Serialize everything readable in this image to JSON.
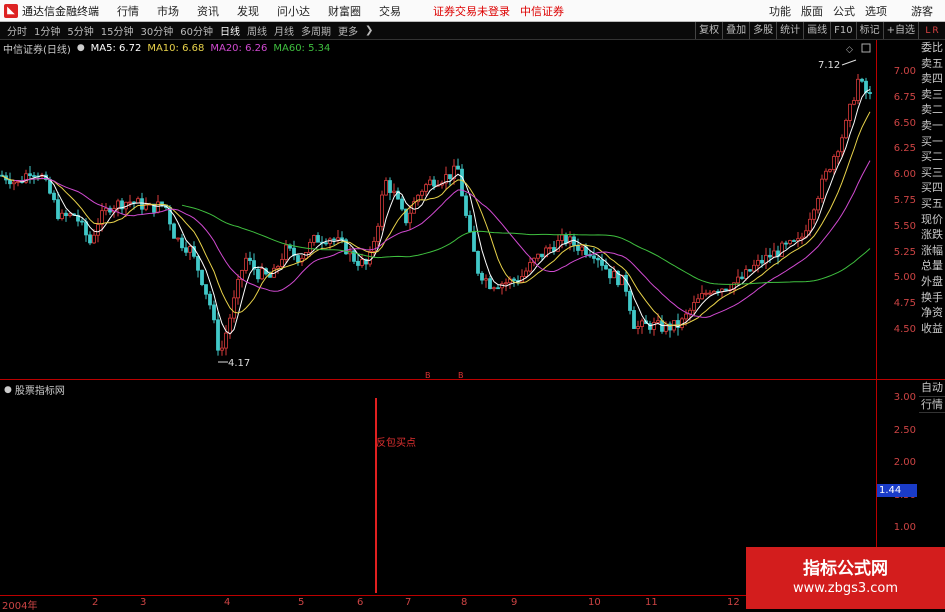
{
  "menubar": {
    "app_title": "通达信金融终端",
    "items": [
      "行情",
      "市场",
      "资讯",
      "发现",
      "问小达",
      "财富圈",
      "交易"
    ],
    "status": "证券交易未登录",
    "broker": "中信证券",
    "right_items": [
      "功能",
      "版面",
      "公式",
      "选项"
    ],
    "guest": "游客"
  },
  "toolbar": {
    "periods": [
      "分时",
      "1分钟",
      "5分钟",
      "15分钟",
      "30分钟",
      "60分钟",
      "日线",
      "周线",
      "月线",
      "多周期",
      "更多"
    ],
    "active_period": "日线",
    "right_buttons": [
      "复权",
      "叠加",
      "多股",
      "统计",
      "画线",
      "F10",
      "标记",
      "+自选",
      "返回"
    ]
  },
  "side_top": {
    "left": "L",
    "right": "R"
  },
  "infobar": {
    "stock": "中信证券(日线)",
    "ma5": "MA5: 6.72",
    "ma10": "MA10: 6.68",
    "ma20": "MA20: 6.26",
    "ma60": "MA60: 5.34"
  },
  "colors": {
    "ma5": "#ffffff",
    "ma10": "#e8d24a",
    "ma20": "#d04ad0",
    "ma60": "#3fbf3f",
    "up": "#d83b3b",
    "down": "#41c8c8"
  },
  "price_axis": [
    "7.00",
    "6.75",
    "6.50",
    "6.25",
    "6.00",
    "5.75",
    "5.50",
    "5.25",
    "5.00",
    "4.75",
    "4.50"
  ],
  "annotations": {
    "high": "7.12",
    "low": "4.17",
    "marks": [
      "B",
      "B"
    ]
  },
  "side_panel": [
    "委比",
    "卖五",
    "卖四",
    "卖三",
    "卖二",
    "卖一",
    "买一",
    "买二",
    "买三",
    "买四",
    "买五",
    "现价",
    "涨跌",
    "涨幅",
    "总量",
    "外盘",
    "换手",
    "净资",
    "收益"
  ],
  "indicator": {
    "name": "股票指标网",
    "signal_text": "反包买点",
    "axis": [
      "3.00",
      "2.50",
      "2.00",
      "1.50",
      "1.00"
    ],
    "current": "1.44"
  },
  "ind_side": [
    "自动",
    "行情"
  ],
  "date_axis": [
    "2004年",
    "2",
    "3",
    "4",
    "5",
    "6",
    "7",
    "8",
    "9",
    "10",
    "11",
    "12"
  ],
  "watermark": {
    "title": "指标公式网",
    "url": "www.zbgs3.com"
  }
}
